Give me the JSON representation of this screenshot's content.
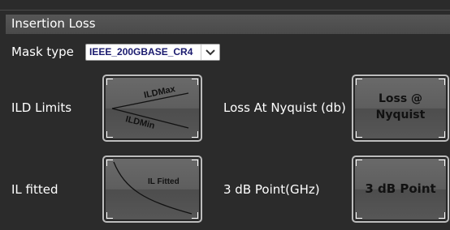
{
  "panel": {
    "title": "Insertion Loss"
  },
  "mask": {
    "label": "Mask type",
    "value": "IEEE_200GBASE_CR4"
  },
  "ild": {
    "label": "ILD Limits",
    "max_label": "ILDMax",
    "min_label": "ILDMin"
  },
  "nyquist": {
    "label": "Loss At Nyquist (db)",
    "button_line1": "Loss @",
    "button_line2": "Nyquist"
  },
  "il_fitted": {
    "label": "IL fitted",
    "button_text": "IL Fitted"
  },
  "three_db": {
    "label": "3 dB Point(GHz)",
    "button_text": "3 dB Point"
  },
  "icons": {
    "dropdown": "chevron-down-icon"
  },
  "colors": {
    "background": "#2b2b2b",
    "header": "#4f4f4f",
    "select_text": "#1a1a6e",
    "tile_border": "#bdbdbd"
  }
}
